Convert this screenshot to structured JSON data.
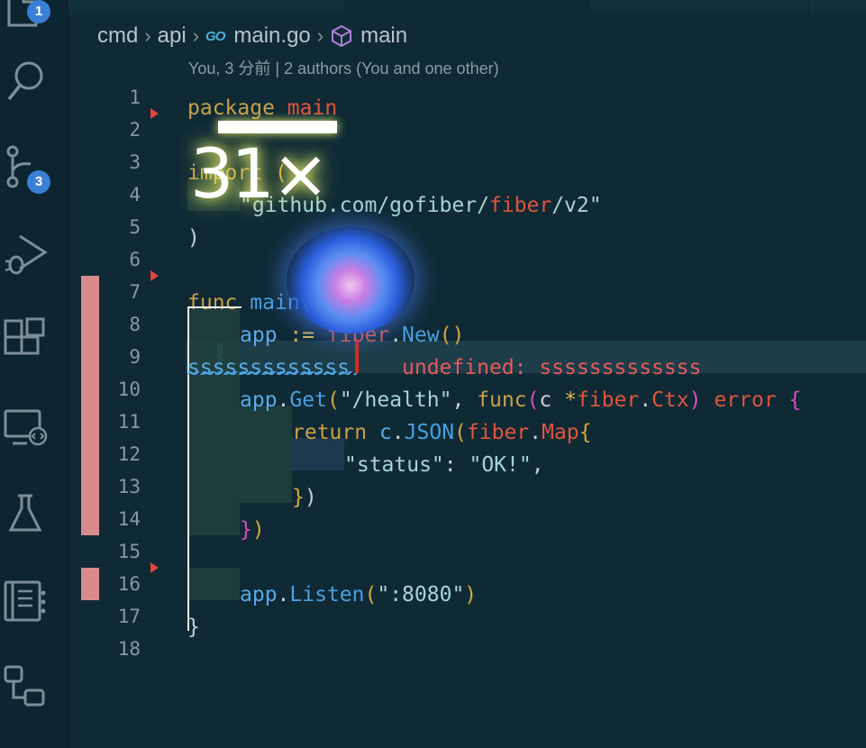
{
  "activity_bar": {
    "items": [
      {
        "icon": "explorer-icon",
        "badge": "1"
      },
      {
        "icon": "search-icon",
        "badge": null
      },
      {
        "icon": "source-control-icon",
        "badge": "3"
      },
      {
        "icon": "run-debug-icon",
        "badge": null
      },
      {
        "icon": "extensions-icon",
        "badge": null
      },
      {
        "icon": "remote-explorer-icon",
        "badge": null
      },
      {
        "icon": "testing-icon",
        "badge": null
      },
      {
        "icon": "notebook-icon",
        "badge": null
      },
      {
        "icon": "flow-diagram-icon",
        "badge": null
      }
    ]
  },
  "breadcrumb": {
    "segments": [
      "cmd",
      "api",
      "main.go",
      "main"
    ],
    "file_icon_label": "GO"
  },
  "codelens": "You, 3 分前 | 2 authors (You and one other)",
  "editor": {
    "line_numbers": [
      "1",
      "2",
      "3",
      "4",
      "5",
      "6",
      "7",
      "8",
      "9",
      "10",
      "11",
      "12",
      "13",
      "14",
      "15",
      "16",
      "17",
      "18"
    ],
    "lines": {
      "l1": [
        "package",
        " main"
      ],
      "l3": [
        "import",
        " ("
      ],
      "l4": [
        "\"github.com/gofiber/",
        "fiber",
        "/v2\""
      ],
      "l5": [
        ")"
      ],
      "l7": [
        "func",
        " main",
        "()",
        " {"
      ],
      "l8": [
        "app",
        " := ",
        "fiber",
        ".",
        "New",
        "()"
      ],
      "l9": [
        "sssssssssssss"
      ],
      "l9_error": "undefined: sssssssssssss",
      "l10": [
        "app",
        ".",
        "Get",
        "(",
        "\"/health\"",
        ", ",
        "func",
        "(",
        "c ",
        "*",
        "fiber",
        ".",
        "Ctx",
        ")",
        " error ",
        "{"
      ],
      "l11": [
        "return",
        " c",
        ".",
        "JSON",
        "(",
        "fiber",
        ".",
        "Map",
        "{"
      ],
      "l12": [
        "\"status\"",
        ": ",
        "\"OK!\"",
        ","
      ],
      "l13": [
        "}",
        ")"
      ],
      "l14": [
        "}",
        ")"
      ],
      "l16": [
        "app",
        ".",
        "Listen",
        "(",
        "\":8080\"",
        ")"
      ],
      "l17": [
        "}"
      ]
    }
  },
  "power_mode": {
    "combo": "31×"
  },
  "colors": {
    "background": "#0f2a35",
    "diff_removed": "#d98b8c",
    "error": "#e65a5a",
    "badge": "#3a7fd6"
  }
}
